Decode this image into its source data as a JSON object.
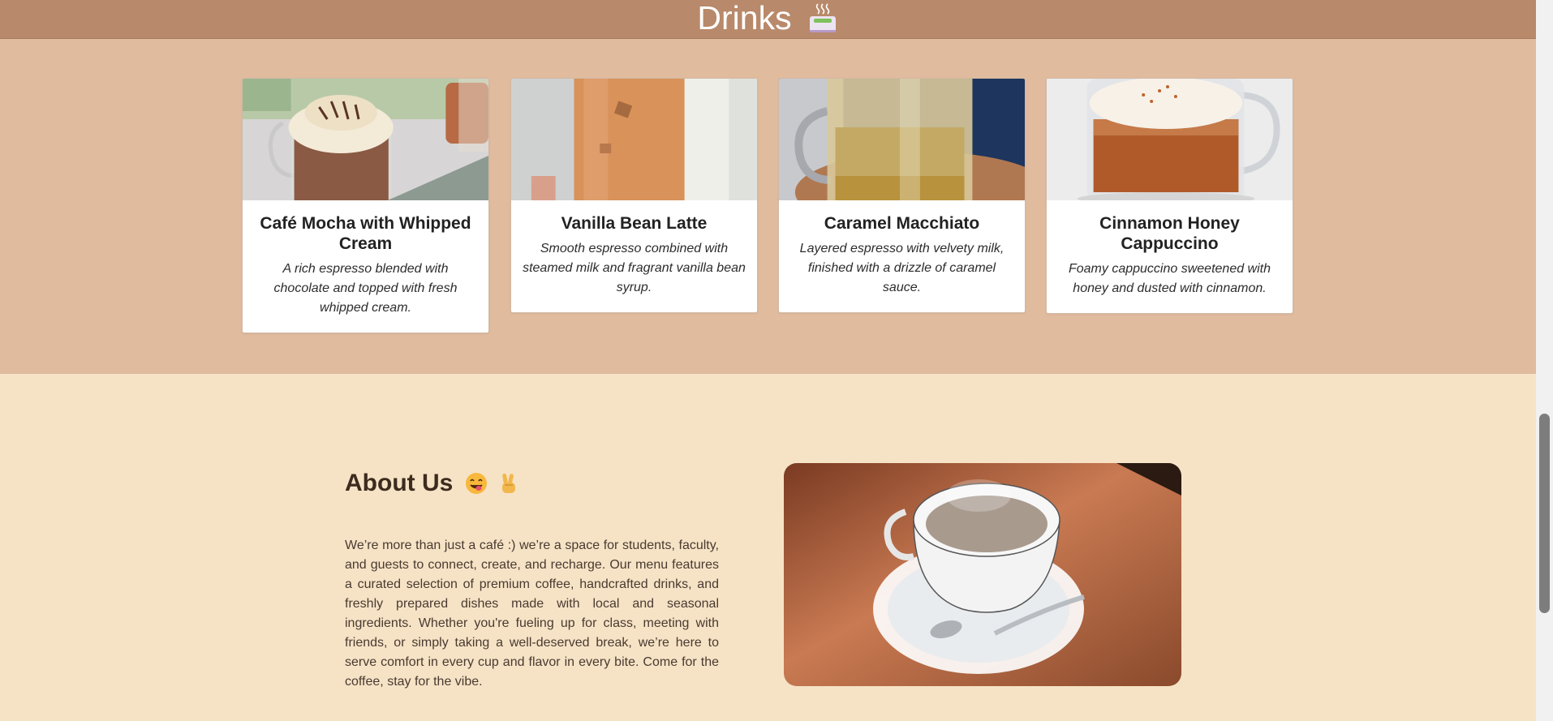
{
  "header": {
    "title": "Drinks",
    "icon": "hot-beverage-icon"
  },
  "drinks": [
    {
      "name": "Café Mocha with Whipped Cream",
      "description": "A rich espresso blended with chocolate and topped with fresh whipped cream."
    },
    {
      "name": "Vanilla Bean Latte",
      "description": "Smooth espresso combined with steamed milk and fragrant vanilla bean syrup."
    },
    {
      "name": "Caramel Macchiato",
      "description": "Layered espresso with velvety milk, finished with a drizzle of caramel sauce."
    },
    {
      "name": "Cinnamon Honey Cappuccino",
      "description": "Foamy cappuccino sweetened with honey and dusted with cinnamon."
    }
  ],
  "about": {
    "title": "About Us",
    "emojis": [
      "face-savoring-food-icon",
      "victory-hand-icon"
    ],
    "text": "We’re more than just a café :) we’re a space for students, faculty, and guests to connect, create, and recharge. Our menu features a curated selection of premium coffee, handcrafted drinks, and freshly prepared dishes made with local and seasonal ingredients. Whether you're fueling up for class, meeting with friends, or simply taking a well-deserved break, we’re here to serve comfort in every cup and flavor in every bite. Come for the coffee, stay for the vibe."
  },
  "colors": {
    "header_bg": "#b8896a",
    "drinks_bg": "#e0bb9e",
    "about_bg": "#f6e3c6",
    "title_text": "#3d2b1f"
  }
}
